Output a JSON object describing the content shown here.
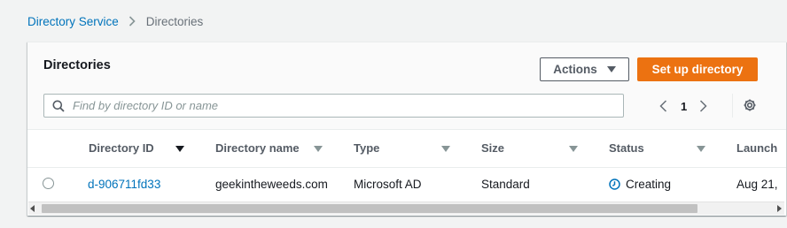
{
  "breadcrumb": {
    "parent": "Directory Service",
    "current": "Directories"
  },
  "panel": {
    "title": "Directories",
    "actions_label": "Actions",
    "primary_label": "Set up directory"
  },
  "search": {
    "placeholder": "Find by directory ID or name",
    "value": ""
  },
  "pagination": {
    "current_page": "1"
  },
  "table": {
    "columns": [
      "Directory ID",
      "Directory name",
      "Type",
      "Size",
      "Status",
      "Launch"
    ],
    "sorted_column": "Directory ID",
    "rows": [
      {
        "directory_id": "d-906711fd33",
        "directory_name": "geekintheweeds.com",
        "type": "Microsoft AD",
        "size": "Standard",
        "status": "Creating",
        "launch": "Aug 21,"
      }
    ]
  },
  "colors": {
    "link": "#0073bb",
    "primary": "#ec7211",
    "text": "#16191f",
    "muted": "#545b64"
  },
  "icons": {
    "breadcrumb_separator": "chevron-right-icon",
    "actions_caret": "caret-down-icon",
    "search": "search-icon",
    "prev_page": "chevron-left-icon",
    "next_page": "chevron-right-icon",
    "settings": "gear-icon",
    "status": "clock-icon",
    "sort_desc": "caret-down-filled-icon",
    "sortable": "caret-down-icon"
  }
}
